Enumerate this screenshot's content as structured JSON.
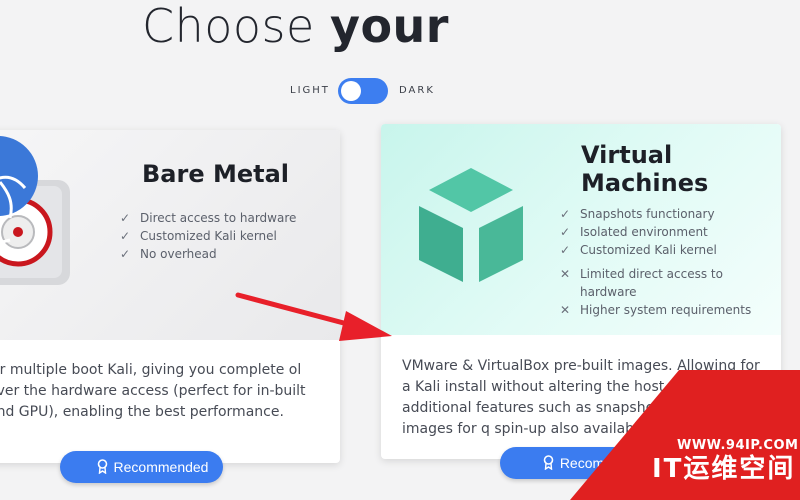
{
  "heading": {
    "prefix": "Choose ",
    "bold": "your"
  },
  "theme_toggle": {
    "light_label": "LIGHT",
    "dark_label": "DARK",
    "state": "light"
  },
  "cards": [
    {
      "title": "Bare Metal",
      "pros": [
        "Direct access to hardware",
        "Customized Kali kernel",
        "No overhead"
      ],
      "cons": [],
      "description": "e or multiple boot Kali, giving you complete ol over the hardware access (perfect for in-built and GPU), enabling the best performance.",
      "button_label": "Recommended"
    },
    {
      "title": "Virtual Machines",
      "pros": [
        "Snapshots functionary",
        "Isolated environment",
        "Customized Kali kernel"
      ],
      "cons": [
        "Limited direct access to hardware",
        "Higher system requirements"
      ],
      "description": "VMware & VirtualBox pre-built images. Allowing for a Kali install without altering the host OS with additional features such as snapshots. Vagrant images for q spin-up also available.",
      "button_label": "Recommend"
    }
  ],
  "icons": {
    "check": "✓",
    "cross": "✕",
    "award": "award-icon",
    "bare_metal": "hard-drive-dragon-icon",
    "virtual_machines": "cube-icon"
  },
  "watermark": {
    "url": "WWW.94IP.COM",
    "brand": "IT运维空间"
  },
  "colors": {
    "accent": "#3b7cf0",
    "vm_banner": "#c8f5ec",
    "cube": "#4dbf9f",
    "arrow": "#e8202a",
    "watermark": "#e02020"
  }
}
